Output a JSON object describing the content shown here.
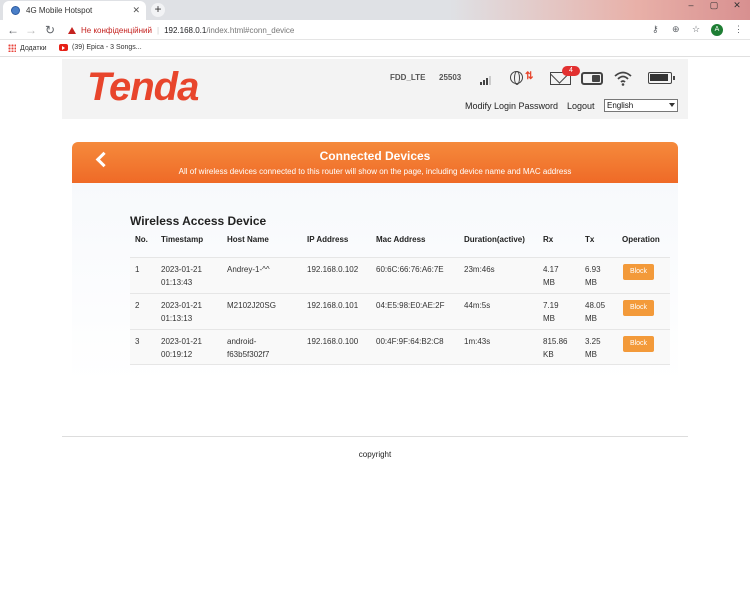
{
  "browser": {
    "tab_title": "4G Mobile Hotspot",
    "tab_close": "✕",
    "new_tab": "+",
    "window_min": "–",
    "window_max": "▢",
    "window_close": "✕",
    "insecure_label": "Не конфіденційний",
    "url_host": "192.168.0.1",
    "url_path": "/index.html#conn_device",
    "avatar_letter": "A",
    "bookmarks": [
      {
        "label": "Додатки",
        "icon": "apps-icon"
      },
      {
        "label": "(39) Epica - 3 Songs...",
        "icon": "youtube-icon"
      }
    ]
  },
  "header": {
    "logo_text": "Tenda",
    "network_type": "FDD_LTE",
    "network_code": "25503",
    "mail_count": "4",
    "modify_password_label": "Modify Login Password",
    "logout_label": "Logout",
    "language_selected": "English",
    "icons": [
      "signal-icon",
      "globe-icon",
      "mail-icon",
      "sim-icon",
      "wifi-icon",
      "battery-icon"
    ]
  },
  "banner": {
    "title": "Connected Devices",
    "subtitle": "All of wireless devices connected to this router will show on the page, including device name and MAC address"
  },
  "section": {
    "title": "Wireless Access Device",
    "columns": [
      "No.",
      "Timestamp",
      "Host Name",
      "IP Address",
      "Mac Address",
      "Duration(active)",
      "Rx",
      "Tx",
      "Operation"
    ],
    "rows": [
      {
        "no": "1",
        "ts1": "2023-01-21",
        "ts2": "01:13:43",
        "host1": "Andrey-1-^^",
        "host2": "",
        "ip": "192.168.0.102",
        "mac": "60:6C:66:76:A6:7E",
        "duration": "23m:46s",
        "rx1": "4.17",
        "rx2": "MB",
        "tx1": "6.93",
        "tx2": "MB",
        "op": "Block"
      },
      {
        "no": "2",
        "ts1": "2023-01-21",
        "ts2": "01:13:13",
        "host1": "M2102J20SG",
        "host2": "",
        "ip": "192.168.0.101",
        "mac": "04:E5:98:E0:AE:2F",
        "duration": "44m:5s",
        "rx1": "7.19",
        "rx2": "MB",
        "tx1": "48.05",
        "tx2": "MB",
        "op": "Block"
      },
      {
        "no": "3",
        "ts1": "2023-01-21",
        "ts2": "00:19:12",
        "host1": "android-",
        "host2": "f63b5f302f7",
        "ip": "192.168.0.100",
        "mac": "00:4F:9F:64:B2:C8",
        "duration": "1m:43s",
        "rx1": "815.86",
        "rx2": "KB",
        "tx1": "3.25",
        "tx2": "MB",
        "op": "Block"
      }
    ]
  },
  "footer": {
    "copyright": "copyright"
  },
  "colors": {
    "brand": "#e8452c",
    "banner": "#ef6a27",
    "block_button": "#f39a3a"
  }
}
